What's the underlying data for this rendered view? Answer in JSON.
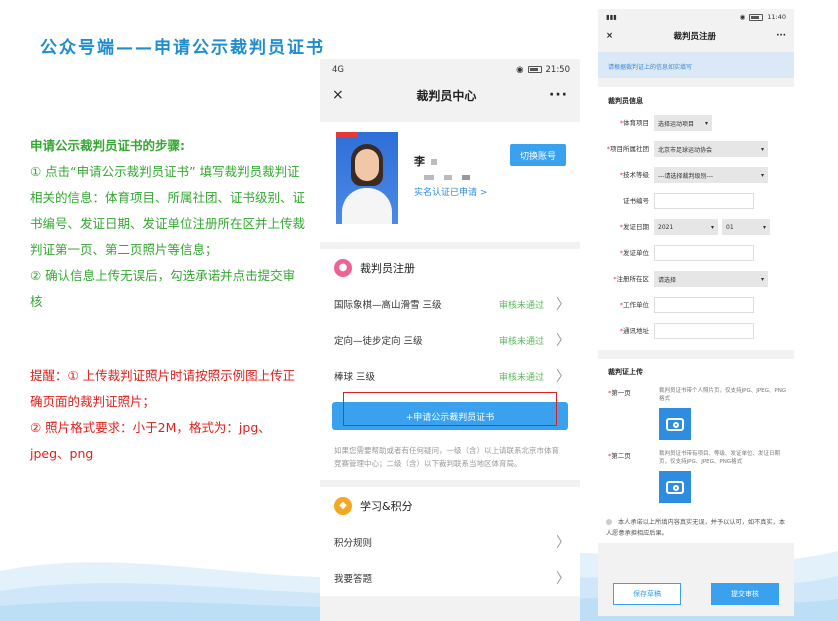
{
  "slide": {
    "title": "公众号端——申请公示裁判员证书",
    "steps_heading": "申请公示裁判员证书的步骤:",
    "step1": "① 点击“申请公示裁判员证书” 填写裁判员裁判证相关的信息：体育项目、所属社团、证书级别、证书编号、发证日期、发证单位注册所在区并上传裁判证第一页、第二页照片等信息；",
    "step2": "② 确认信息上传无误后，勾选承诺并点击提交审核",
    "tip1": "提醒：① 上传裁判证照片时请按照示例图上传正确页面的裁判证照片；",
    "tip2": "② 照片格式要求：小于2M，格式为：jpg、jpeg、png"
  },
  "phone1": {
    "status_time": "21:50",
    "status_left": "4G",
    "title": "裁判员中心",
    "close": "×",
    "more": "···",
    "profile": {
      "name": "李",
      "verified": "实名认证已申请 >",
      "switch_btn": "切换账号"
    },
    "referee_section": {
      "title": "裁判员注册",
      "rows": [
        {
          "label": "国际象棋—高山滑雪  三级",
          "status": "审核未通过"
        },
        {
          "label": "定向—徒步定向  三级",
          "status": "审核未通过"
        },
        {
          "label": "棒球  三级",
          "status": "审核未通过"
        }
      ],
      "apply_btn": "+申请公示裁判员证书",
      "help": "如果您需要帮助或者有任何疑问，一级（含）以上请联系北京市体育竞赛管理中心；二级（含）以下裁判联系当地区体育局。"
    },
    "study_section": {
      "title": "学习&积分",
      "rows": [
        "积分规则",
        "我要答题"
      ]
    }
  },
  "phone2": {
    "status_time": "11:40",
    "title": "裁判员注册",
    "close": "×",
    "more": "···",
    "notice": "请根据裁判证上的信息如实填写",
    "info_title": "裁判员信息",
    "fields": [
      {
        "label": "体育项目",
        "required": "*",
        "value": "选择运动项目"
      },
      {
        "label": "项目所属社团",
        "required": "*",
        "value": "北京市足球运动协会"
      },
      {
        "label": "技术等级",
        "required": "*",
        "value": "---请选择裁判级别---"
      },
      {
        "label": "证书编号",
        "required": "",
        "value": ""
      },
      {
        "label": "发证日期",
        "required": "*",
        "value": "2021",
        "value2": "01"
      },
      {
        "label": "发证单位",
        "required": "*",
        "value": ""
      },
      {
        "label": "注册所在区",
        "required": "*",
        "value": "请选择"
      },
      {
        "label": "工作单位",
        "required": "*",
        "value": ""
      },
      {
        "label": "通讯地址",
        "required": "*",
        "value": ""
      }
    ],
    "upload_title": "裁判证上传",
    "uploads": [
      {
        "label": "第一页",
        "desc": "裁判员证书带个人照片页，仅支持JPG、JPEG、PNG格式"
      },
      {
        "label": "第二页",
        "desc": "裁判员证书带有项目、等级、发证单位、发证日期页，仅支持JPG、JPEG、PNG格式"
      }
    ],
    "agree": "本人承诺以上所填内容真实无误，并予以认可，如不真实，本人愿意承担相应后果。",
    "draft_btn": "保存草稿",
    "submit_btn": "提交审核"
  }
}
